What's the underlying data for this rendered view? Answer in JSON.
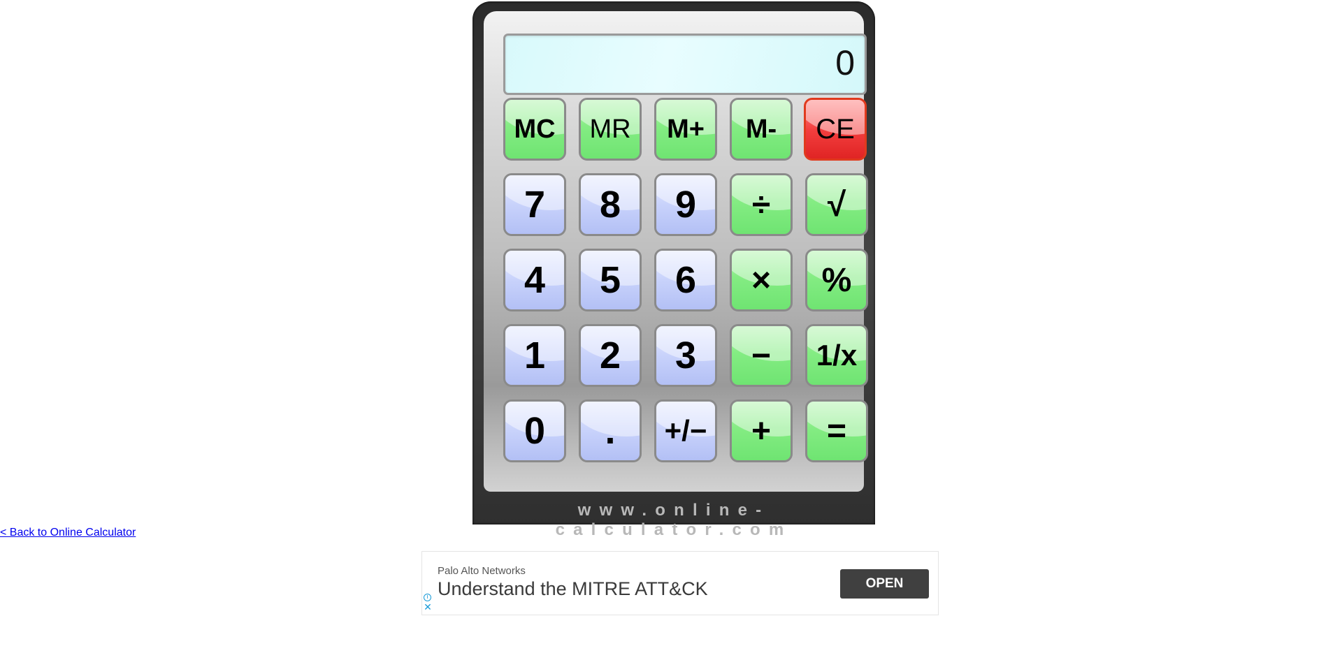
{
  "display": {
    "value": "0"
  },
  "keys": {
    "mc": "MC",
    "mr": "MR",
    "m_plus": "M+",
    "m_minus": "M-",
    "ce": "CE",
    "seven": "7",
    "eight": "8",
    "nine": "9",
    "divide": "÷",
    "sqrt": "√",
    "four": "4",
    "five": "5",
    "six": "6",
    "multiply": "×",
    "percent": "%",
    "one": "1",
    "two": "2",
    "three": "3",
    "minus": "−",
    "reciprocal": "1/x",
    "zero": "0",
    "decimal": ".",
    "plus_minus": "+/−",
    "plus": "+",
    "equals": "="
  },
  "branding": "www.online-calculator.com",
  "back_link": "< Back to Online Calculator",
  "ad": {
    "sponsor": "Palo Alto Networks",
    "headline": "Understand the MITRE ATT&CK",
    "button": "OPEN",
    "info_icon": "info-icon",
    "close_icon": "close-icon"
  },
  "colors": {
    "memory_keys": "#84ec83",
    "number_keys": "#c8d2fb",
    "clear_key": "#f33f3f",
    "display_bg": "#e0fbfd",
    "ad_button": "#404040",
    "link": "#0000ee"
  }
}
